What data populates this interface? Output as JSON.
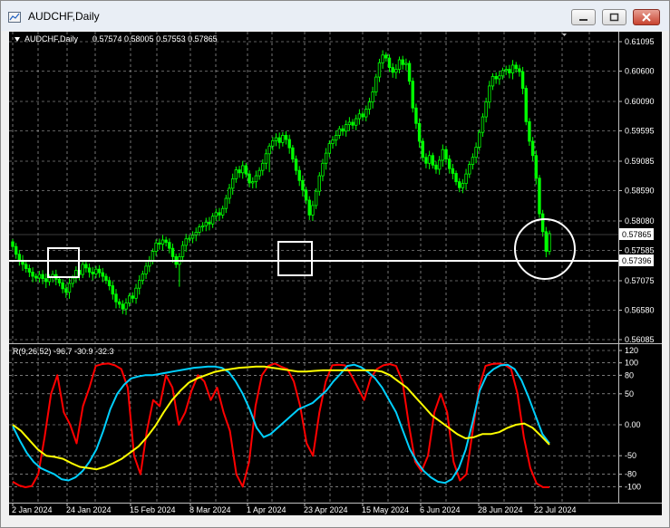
{
  "window": {
    "title": "AUDCHF,Daily"
  },
  "chart": {
    "header_symbol": "AUDCHF,Daily",
    "header_ohlc": "0.57574 0.58005 0.57553 0.57865",
    "price_ticks": [
      "0.61095",
      "0.60600",
      "0.60090",
      "0.59595",
      "0.59085",
      "0.58590",
      "0.58080",
      "0.57585",
      "0.57075",
      "0.56580",
      "0.56085"
    ],
    "current_price_label": "0.57865",
    "hline_price_label": "0.57396",
    "date_ticks": [
      "2 Jan 2024",
      "24 Jan 2024",
      "15 Feb 2024",
      "8 Mar 2024",
      "1 Apr 2024",
      "23 Apr 2024",
      "15 May 2024",
      "6 Jun 2024",
      "28 Jun 2024",
      "22 Jul 2024"
    ],
    "indicator_label": "R(9,26,52) -96.7 -30.9 -32.3",
    "indicator_ticks": [
      "120",
      "100",
      "80",
      "50",
      "0.00",
      "-50",
      "-80",
      "-100"
    ],
    "colors": {
      "background": "#000000",
      "candles": "#00ff00",
      "grid": "#c0c0c0",
      "hline": "#ffffff",
      "line_red": "#ff0000",
      "line_cyan": "#00d0ff",
      "line_yellow": "#ffff00"
    }
  },
  "chart_data": {
    "type": "line",
    "title": "AUDCHF,Daily",
    "price_range": [
      0.56085,
      0.61095
    ],
    "horizontal_line": 0.57396,
    "last_price": 0.57865,
    "series": [
      {
        "values": [
          0.5765,
          0.5752,
          0.5742,
          0.5735,
          0.5728,
          0.5722,
          0.5715,
          0.5712,
          0.5718,
          0.5711,
          0.5706,
          0.5713,
          0.5718,
          0.571,
          0.5704,
          0.5694,
          0.5688,
          0.5703,
          0.5712,
          0.5725,
          0.5718,
          0.5735,
          0.5729,
          0.5722,
          0.5719,
          0.5727,
          0.5721,
          0.5715,
          0.5708,
          0.5699,
          0.5685,
          0.5672,
          0.5668,
          0.566,
          0.567,
          0.5682,
          0.5678,
          0.5695,
          0.5708,
          0.5719,
          0.5732,
          0.5741,
          0.5757,
          0.5771,
          0.5769,
          0.5776,
          0.5772,
          0.5762,
          0.5748,
          0.5735,
          0.5748,
          0.5767,
          0.5778,
          0.5779,
          0.5784,
          0.5789,
          0.5798,
          0.58,
          0.5806,
          0.5803,
          0.5816,
          0.5822,
          0.5818,
          0.5829,
          0.5846,
          0.5863,
          0.5879,
          0.5894,
          0.5889,
          0.5901,
          0.5887,
          0.5872,
          0.5874,
          0.5884,
          0.5893,
          0.5905,
          0.5921,
          0.5934,
          0.5943,
          0.5948,
          0.594,
          0.5952,
          0.5945,
          0.5931,
          0.5912,
          0.5893,
          0.5876,
          0.586,
          0.5843,
          0.5818,
          0.5834,
          0.5858,
          0.5884,
          0.5905,
          0.5922,
          0.5938,
          0.5944,
          0.5952,
          0.5963,
          0.5959,
          0.597,
          0.5974,
          0.5969,
          0.598,
          0.5988,
          0.5983,
          0.5996,
          0.6008,
          0.6025,
          0.605,
          0.6074,
          0.6087,
          0.6082,
          0.6066,
          0.6058,
          0.6063,
          0.6079,
          0.6071,
          0.6073,
          0.6043,
          0.5998,
          0.5972,
          0.5942,
          0.5915,
          0.5905,
          0.5918,
          0.5902,
          0.5895,
          0.591,
          0.5928,
          0.5912,
          0.5896,
          0.5888,
          0.5874,
          0.5864,
          0.5871,
          0.5887,
          0.5903,
          0.5915,
          0.5932,
          0.5957,
          0.5983,
          0.6008,
          0.6035,
          0.6051,
          0.6047,
          0.6052,
          0.6061,
          0.6063,
          0.6057,
          0.607,
          0.6064,
          0.6059,
          0.6031,
          0.5975,
          0.5942,
          0.5918,
          0.588,
          0.582,
          0.579,
          0.5757,
          0.5787
        ]
      },
      {
        "name": "R(9,26,52) -96.7",
        "values": [
          -92,
          -98,
          -101,
          -99,
          -80,
          -20,
          50,
          80,
          20,
          0,
          -30,
          30,
          60,
          95,
          98,
          99,
          96,
          90,
          60,
          -50,
          -80,
          -10,
          40,
          30,
          80,
          60,
          0,
          20,
          55,
          80,
          70,
          40,
          60,
          20,
          -10,
          -80,
          -100,
          -60,
          30,
          80,
          95,
          99,
          94,
          90,
          70,
          30,
          -30,
          -50,
          20,
          70,
          96,
          97,
          96,
          80,
          60,
          40,
          75,
          90,
          96,
          98,
          95,
          70,
          0,
          -60,
          -75,
          -50,
          20,
          50,
          20,
          -60,
          -90,
          -80,
          -10,
          60,
          95,
          98,
          99,
          97,
          90,
          50,
          -20,
          -70,
          -95,
          -101,
          -101
        ]
      },
      {
        "name": "-30.9",
        "values": [
          -2,
          -25,
          -45,
          -60,
          -70,
          -75,
          -80,
          -88,
          -90,
          -85,
          -75,
          -60,
          -40,
          -10,
          25,
          50,
          65,
          75,
          78,
          80,
          80,
          82,
          84,
          86,
          88,
          90,
          92,
          93,
          94,
          94,
          92,
          85,
          70,
          50,
          25,
          -5,
          -20,
          -15,
          -5,
          5,
          15,
          25,
          30,
          35,
          45,
          55,
          70,
          82,
          95,
          97,
          93,
          85,
          75,
          60,
          40,
          20,
          -10,
          -40,
          -60,
          -75,
          -85,
          -92,
          -94,
          -88,
          -70,
          -40,
          5,
          55,
          80,
          90,
          96,
          97,
          90,
          72,
          45,
          15,
          -15,
          -30
        ]
      },
      {
        "name": "-32.3",
        "values": [
          0,
          -10,
          -25,
          -40,
          -50,
          -52,
          -55,
          -62,
          -68,
          -70,
          -72,
          -68,
          -62,
          -55,
          -45,
          -35,
          -20,
          -2,
          20,
          40,
          55,
          68,
          75,
          80,
          85,
          88,
          90,
          92,
          93,
          94,
          94,
          92,
          90,
          88,
          86,
          86,
          87,
          88,
          88,
          88,
          88,
          88,
          88,
          88,
          86,
          80,
          70,
          60,
          45,
          30,
          15,
          5,
          -5,
          -15,
          -22,
          -20,
          -15,
          -15,
          -12,
          -5,
          0,
          2,
          -5,
          -18,
          -32
        ]
      }
    ]
  }
}
